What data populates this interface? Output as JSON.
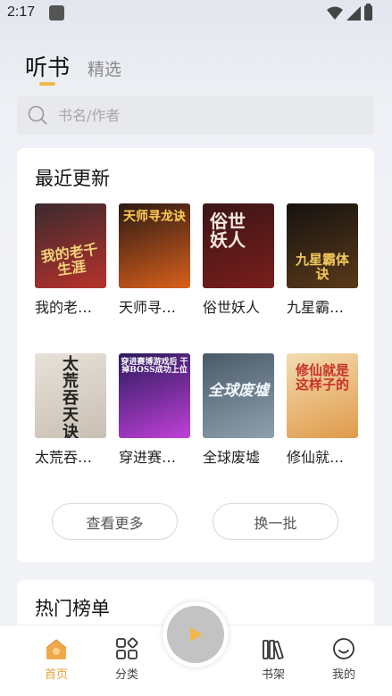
{
  "status": {
    "time": "2:17"
  },
  "tabs": [
    {
      "label": "听书",
      "active": true
    },
    {
      "label": "精选",
      "active": false
    }
  ],
  "search": {
    "placeholder": "书名/作者"
  },
  "recent": {
    "title": "最近更新",
    "books": [
      {
        "title": "我的老…",
        "cover_text": "我的老千生涯",
        "colors": [
          "#3a2a2e",
          "#b8322c"
        ]
      },
      {
        "title": "天师寻…",
        "cover_text": "天师寻龙诀",
        "colors": [
          "#2b1a14",
          "#d9601c"
        ]
      },
      {
        "title": "俗世妖人",
        "cover_text": "俗世妖人",
        "colors": [
          "#3b1516",
          "#7a1e1c"
        ]
      },
      {
        "title": "九星霸…",
        "cover_text": "九星霸体诀",
        "colors": [
          "#161210",
          "#5a3a1a"
        ]
      },
      {
        "title": "太荒吞…",
        "cover_text": "太荒吞天诀",
        "colors": [
          "#e7e1d8",
          "#c9c0b4"
        ]
      },
      {
        "title": "穿进赛…",
        "cover_text": "穿进赛博游戏后 干掉BOSS成功上位",
        "colors": [
          "#2a1a5c",
          "#c040d8"
        ]
      },
      {
        "title": "全球废墟",
        "cover_text": "全球废墟",
        "colors": [
          "#4a5a68",
          "#8fa0ae"
        ]
      },
      {
        "title": "修仙就…",
        "cover_text": "修仙就是这样子的",
        "colors": [
          "#f2dcb0",
          "#e09a4a"
        ]
      }
    ],
    "more_label": "查看更多",
    "refresh_label": "换一批"
  },
  "hot": {
    "title": "热门榜单"
  },
  "nav": [
    {
      "label": "首页",
      "icon": "home-icon",
      "active": true
    },
    {
      "label": "分类",
      "icon": "category-icon",
      "active": false
    },
    {
      "label": "书架",
      "icon": "bookshelf-icon",
      "active": false
    },
    {
      "label": "我的",
      "icon": "profile-icon",
      "active": false
    }
  ],
  "colors": {
    "accent": "#e7a23a",
    "tab_indicator": "#f0b848",
    "play_button": "#c3c3c3"
  }
}
